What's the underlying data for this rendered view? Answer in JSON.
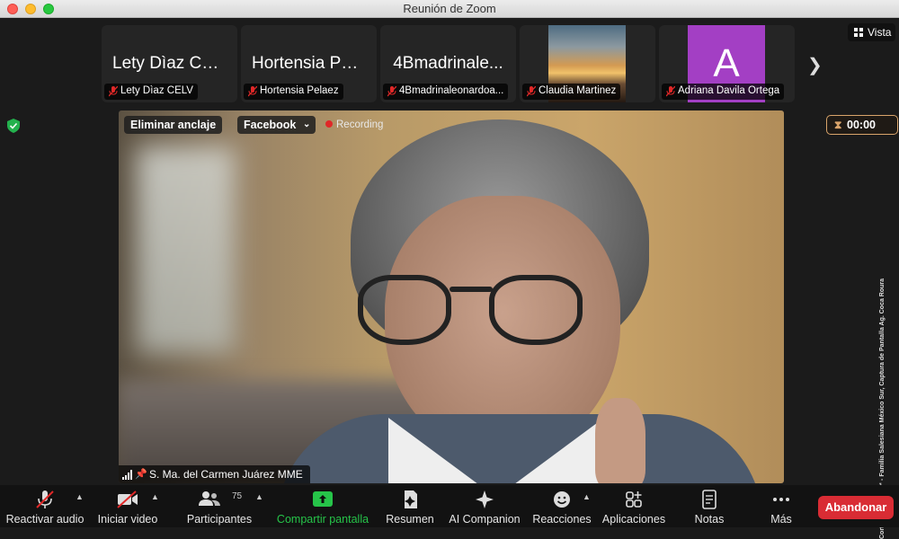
{
  "window": {
    "title": "Reunión de Zoom"
  },
  "gallery": {
    "tiles": [
      {
        "display": "Lety Dìaz CE...",
        "name": "Lety Dìaz CELV",
        "type": "text"
      },
      {
        "display": "Hortensia Pel...",
        "name": "Hortensia Pelaez",
        "type": "text"
      },
      {
        "display": "4Bmadrinale...",
        "name": "4Bmadrinaleonardoa...",
        "type": "text"
      },
      {
        "display": "",
        "name": "Claudia Martinez",
        "type": "photo"
      },
      {
        "display": "A",
        "name": "Adriana Davila Ortega",
        "type": "avatar"
      }
    ],
    "next_icon": "chevron-right-icon"
  },
  "view_button": {
    "label": "Vista"
  },
  "main_video": {
    "unpin_label": "Eliminar anclaje",
    "stream_label": "Facebook",
    "recording_label": "Recording",
    "speaker_name": "S. Ma. del Carmen Juárez MME"
  },
  "timer": {
    "value": "00:00"
  },
  "credit": "Cortesía © Zoom™ - Familia Salesiana México Sur, Captura de Pantalla Ag. Coca Roura",
  "toolbar": {
    "mute_label": "Reactivar audio",
    "video_label": "Iniciar video",
    "participants_label": "Participantes",
    "participants_count": "75",
    "share_label": "Compartir pantalla",
    "summary_label": "Resumen",
    "companion_label": "AI Companion",
    "reactions_label": "Reacciones",
    "apps_label": "Aplicaciones",
    "notes_label": "Notas",
    "more_label": "Más",
    "leave_label": "Abandonar"
  },
  "colors": {
    "share_green": "#26c449",
    "leave_red": "#d92c34",
    "avatar_purple": "#a33fc4",
    "timer_border": "#d9a46b"
  }
}
